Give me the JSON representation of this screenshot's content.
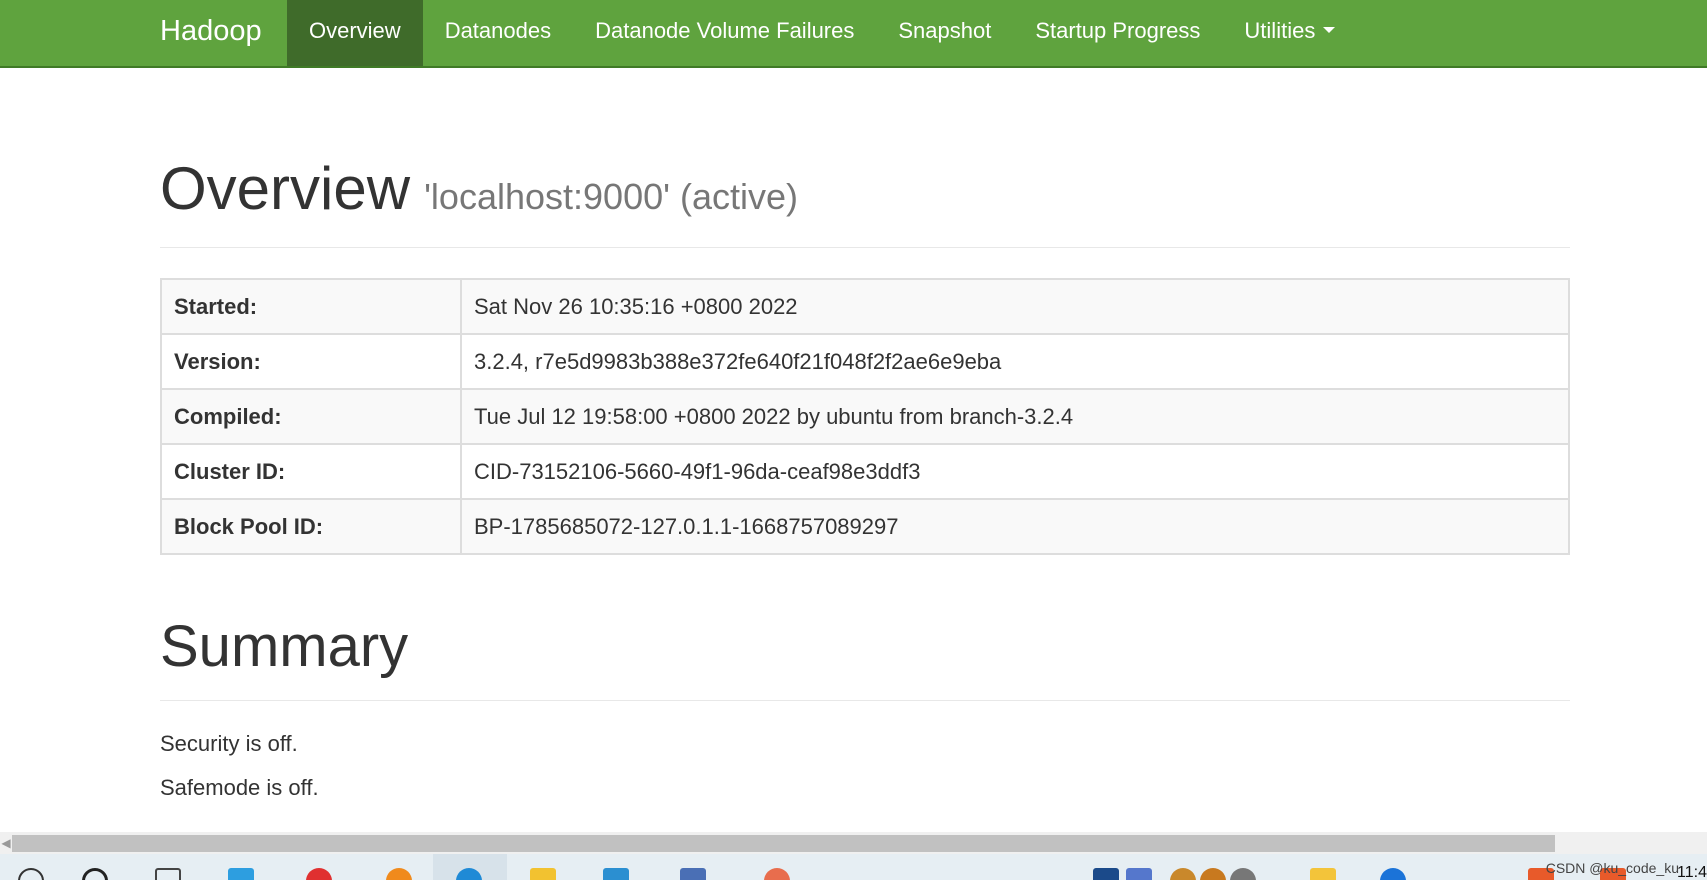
{
  "navbar": {
    "brand": "Hadoop",
    "items": [
      {
        "label": "Overview",
        "active": true
      },
      {
        "label": "Datanodes",
        "active": false
      },
      {
        "label": "Datanode Volume Failures",
        "active": false
      },
      {
        "label": "Snapshot",
        "active": false
      },
      {
        "label": "Startup Progress",
        "active": false
      },
      {
        "label": "Utilities",
        "active": false,
        "dropdown": true
      }
    ],
    "color": "#5fa33e",
    "active_color": "#3f6b2a"
  },
  "overview": {
    "title": "Overview",
    "subtitle": "'localhost:9000' (active)",
    "rows": [
      {
        "key": "Started:",
        "value": "Sat Nov 26 10:35:16 +0800 2022"
      },
      {
        "key": "Version:",
        "value": "3.2.4, r7e5d9983b388e372fe640f21f048f2f2ae6e9eba"
      },
      {
        "key": "Compiled:",
        "value": "Tue Jul 12 19:58:00 +0800 2022 by ubuntu from branch-3.2.4"
      },
      {
        "key": "Cluster ID:",
        "value": "CID-73152106-5660-49f1-96da-ceaf98e3ddf3"
      },
      {
        "key": "Block Pool ID:",
        "value": "BP-1785685072-127.0.1.1-1668757089297"
      }
    ]
  },
  "summary": {
    "title": "Summary",
    "security": "Security is off.",
    "safemode": "Safemode is off."
  },
  "taskbar": {
    "watermark": "CSDN @ku_code_ku",
    "clock": "11:4"
  }
}
